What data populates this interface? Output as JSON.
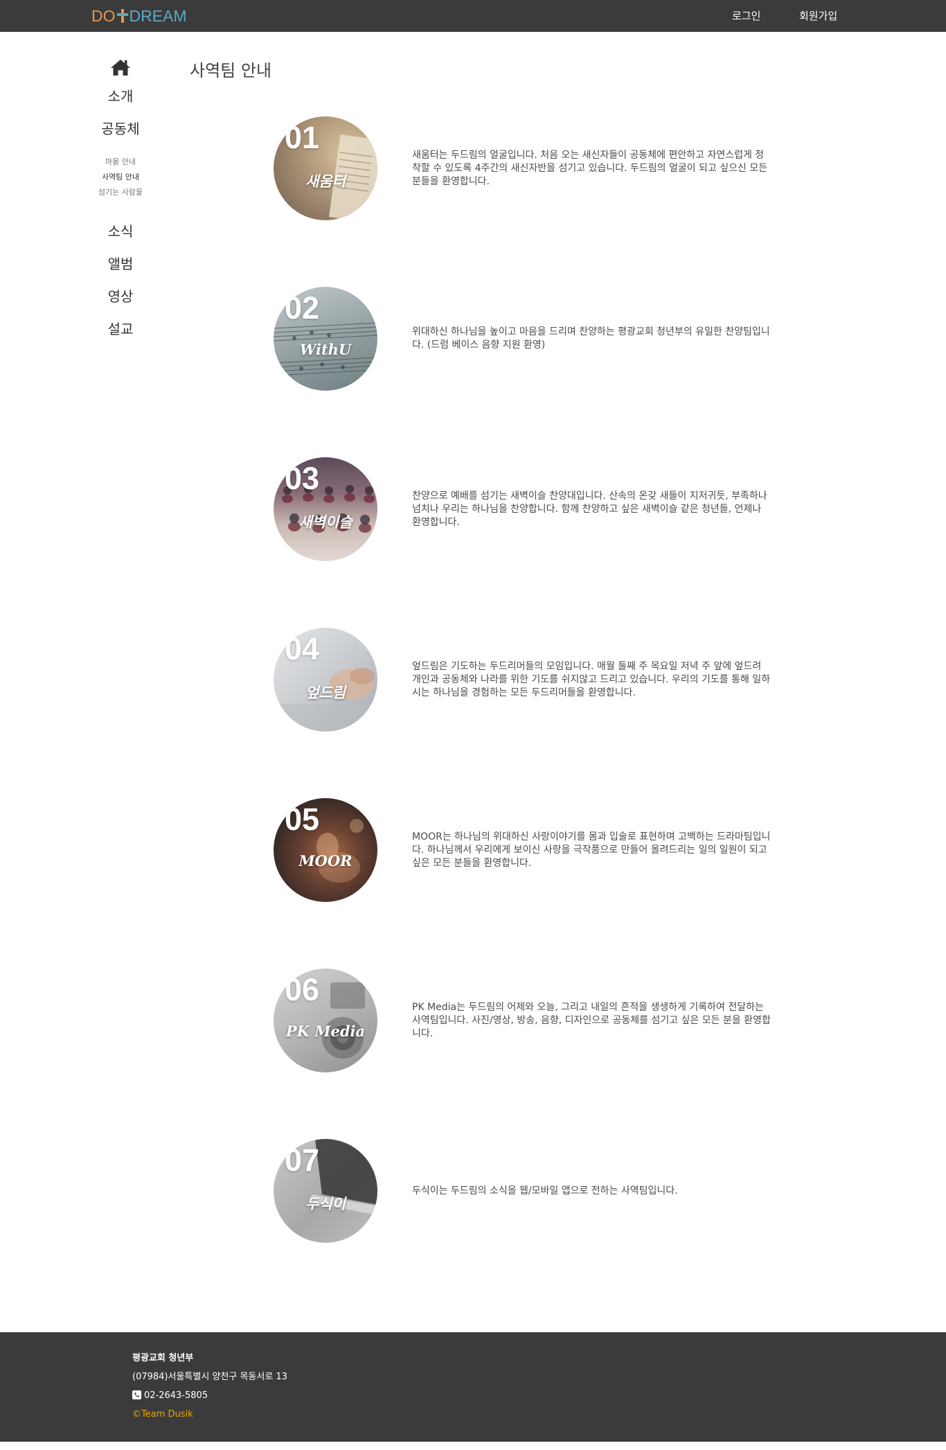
{
  "header": {
    "logo": {
      "part1": "DO",
      "part2": "DREAM"
    },
    "nav": {
      "login": "로그인",
      "signup": "회원가입"
    }
  },
  "sidebar": {
    "home_icon": "home-icon",
    "items": [
      {
        "label": "소개"
      },
      {
        "label": "공동체"
      },
      {
        "label": "소식"
      },
      {
        "label": "앨범"
      },
      {
        "label": "영상"
      },
      {
        "label": "설교"
      }
    ],
    "sub_items": [
      {
        "label": "마을 안내",
        "active": false
      },
      {
        "label": "사역팀 안내",
        "active": true
      },
      {
        "label": "섬기는 사람들",
        "active": false
      }
    ]
  },
  "main": {
    "title": "사역팀 안내",
    "teams": [
      {
        "num": "01",
        "name": "새움터",
        "desc": "새움터는 두드림의 얼굴입니다. 처음 오는 새신자들이 공동체에 편안하고 자연스럽게 정착할 수 있도록 4주간의 새신자반을 섬기고 있습니다. 두드림의 얼굴이 되고 싶으신 모든 분들을 환영합니다."
      },
      {
        "num": "02",
        "name": "WithU",
        "desc": "위대하신 하나님을 높이고 마음을 드리며 찬양하는 평광교회 청년부의 유일한 찬양팀입니다. (드럼 베이스 음향 지원 환영)"
      },
      {
        "num": "03",
        "name": "새벽이슬",
        "desc": "찬양으로 예배를 섬기는 새벽이슬 찬양대입니다. 산속의 온갖 새들이 지저귀듯, 부족하나 넘치나 우리는 하나님을 찬양합니다. 함께 찬양하고 싶은 새벽이슬 같은 청년들, 언제나 환영합니다."
      },
      {
        "num": "04",
        "name": "엎드림",
        "desc": "엎드림은 기도하는 두드리머들의 모임입니다. 매월 둘째 주 목요일 저녁 주 앞에 엎드려 개인과 공동체와 나라를 위한 기도를 쉬지않고 드리고 있습니다. 우리의 기도를 통해 일하시는 하나님을 경험하는 모든 두드리머들을 환영합니다."
      },
      {
        "num": "05",
        "name": "MOOR",
        "desc": "MOOR는 하나님의 위대하신 사랑이야기를 몸과 입술로 표현하며 고백하는 드라마팀입니다. 하나님께서 우리에게 보이신 사랑을 극작품으로 만들어 올려드리는 일의 일원이 되고 싶은 모든 분들을 환영합니다."
      },
      {
        "num": "06",
        "name": "PK Media",
        "desc": "PK Media는 두드림의 어제와 오늘, 그리고 내일의 흔적을 생생하게 기록하여 전달하는 사역팀입니다. 사진/영상, 방송, 음향, 디자인으로 공동체를 섬기고 싶은 모든 분을 환영합니다."
      },
      {
        "num": "07",
        "name": "두식이",
        "desc": "두식이는 두드림의 소식을 웹/모바일 앱으로 전하는 사역팀입니다."
      }
    ]
  },
  "footer": {
    "org": "평광교회 청년부",
    "address": "(07984)서울특별시 양천구 목동서로 13",
    "phone": "02-2643-5805",
    "phone_icon": "phone-icon",
    "copyright": "©Team Dusik"
  },
  "colors": {
    "topbar": "#3b3b3b",
    "footer": "#3b3b3b",
    "logo_orange": "#e8944a",
    "logo_blue": "#5aaac4",
    "copyright": "#f0a500"
  }
}
